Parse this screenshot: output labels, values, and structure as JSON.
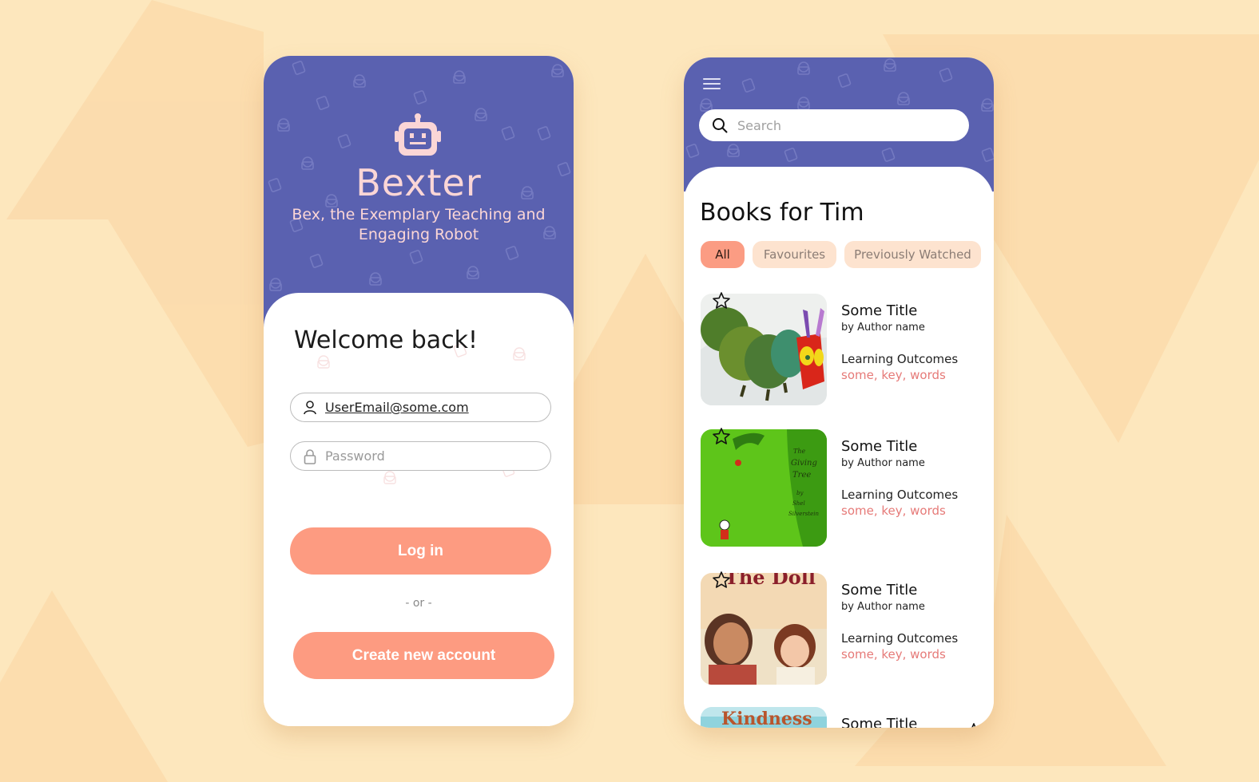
{
  "colors": {
    "background": "#fde7bd",
    "hero": "#5a61b0",
    "accent": "#fd9b81",
    "brand_text": "#fbd6d6",
    "keyword_text": "#e67a78"
  },
  "login": {
    "brand_icon": "robot-icon",
    "brand_name": "Bexter",
    "tagline": "Bex, the Exemplary Teaching and Engaging Robot",
    "welcome": "Welcome back!",
    "email": {
      "value": "UserEmail@some.com",
      "icon": "user-icon"
    },
    "password": {
      "placeholder": "Password",
      "icon": "lock-icon"
    },
    "login_label": "Log in",
    "or_label": "- or -",
    "create_label": "Create new account"
  },
  "books": {
    "menu_icon": "hamburger-menu-icon",
    "search": {
      "placeholder": "Search",
      "icon": "search-icon"
    },
    "title": "Books for Tim",
    "filters": [
      {
        "label": "All",
        "active": true
      },
      {
        "label": "Favourites",
        "active": false
      },
      {
        "label": "Previously Watched",
        "active": false
      }
    ],
    "items": [
      {
        "title": "Some Title",
        "author": "by Author name",
        "outcomes_label": "Learning Outcomes",
        "keywords": "some, key, words",
        "cover": "caterpillar-cover"
      },
      {
        "title": "Some Title",
        "author": "by Author name",
        "outcomes_label": "Learning Outcomes",
        "keywords": "some, key, words",
        "cover": "giving-tree-cover",
        "cover_text": "The Giving Tree by Shel Silverstein"
      },
      {
        "title": "Some Title",
        "author": "by Author name",
        "outcomes_label": "Learning Outcomes",
        "keywords": "some, key, words",
        "cover": "the-doll-cover",
        "cover_text": "The Doll"
      },
      {
        "title": "Some Title",
        "cover": "kindness-cover",
        "cover_text": "Kindness"
      }
    ]
  }
}
